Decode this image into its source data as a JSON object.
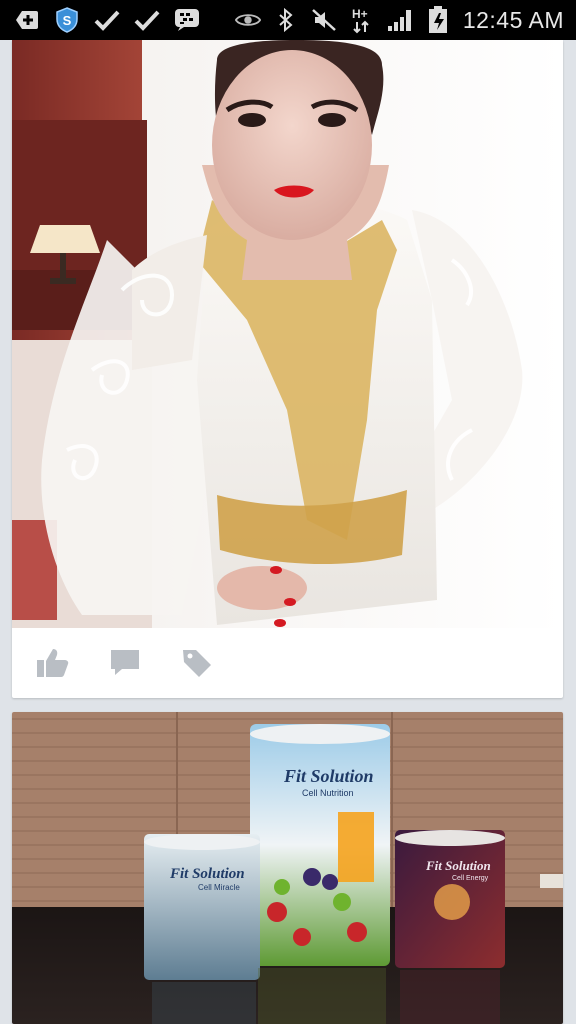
{
  "status_bar": {
    "time": "12:45 AM",
    "left_icons": [
      "add-icon",
      "shield-icon",
      "check-icon",
      "check-icon",
      "bbm-icon"
    ],
    "right_icons": [
      "eye-icon",
      "bluetooth-icon",
      "mute-icon",
      "hplus-icon",
      "signal-icon",
      "battery-icon"
    ],
    "network_label": "H+"
  },
  "feed": {
    "post_1": {
      "photo_alt": "Woman in white lace kebaya with gold embroidery",
      "actions": [
        "like-icon",
        "comment-icon",
        "tag-icon"
      ]
    },
    "post_2": {
      "photo_alt": "Three Fit Solution cans on a table",
      "products": [
        {
          "brand": "Fit Solution",
          "subtitle": "Cell Miracle"
        },
        {
          "brand": "Fit Solution",
          "subtitle": "Cell Nutrition"
        },
        {
          "brand": "Fit Solution",
          "subtitle": "Cell Energy"
        }
      ]
    }
  },
  "colors": {
    "status_bar": "#000000",
    "feed_background": "#dfe3e8",
    "card": "#ffffff",
    "action_icon": "#b9bec4"
  }
}
